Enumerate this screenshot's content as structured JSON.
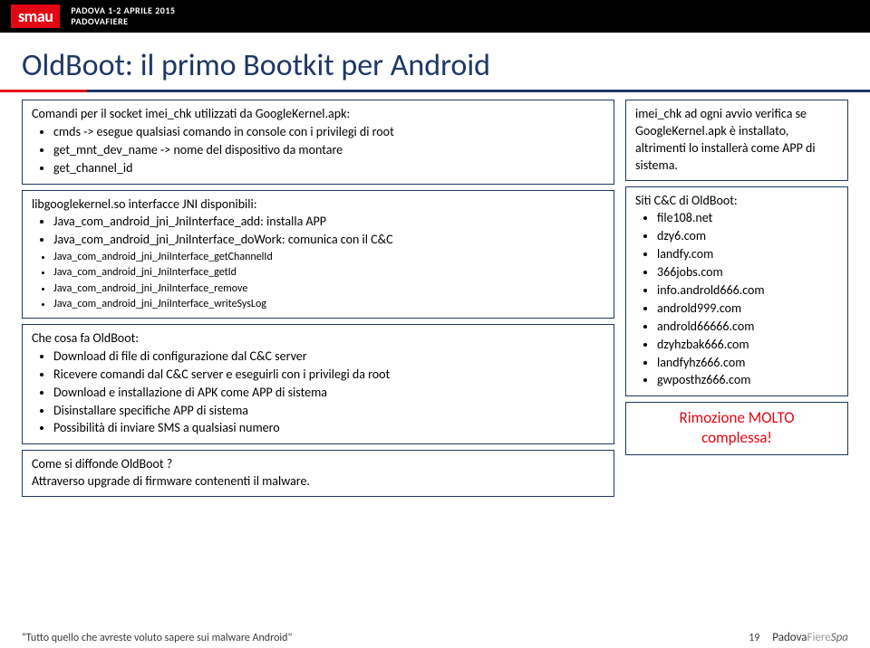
{
  "header": {
    "logo": "smau",
    "line1": "PADOVA 1-2 APRILE 2015",
    "line2": "PADOVAFIERE"
  },
  "title": "OldBoot: il primo Bootkit per Android",
  "left": {
    "box1": {
      "intro": "Comandi per il socket imei_chk utilizzati da GoogleKernel.apk:",
      "items": [
        "cmds -> esegue qualsiasi comando in console con i privilegi di root",
        "get_mnt_dev_name -> nome del dispositivo da montare",
        "get_channel_id"
      ]
    },
    "box2": {
      "intro": "libgooglekernel.so interfacce JNI disponibili:",
      "items": [
        "Java_com_android_jni_JniInterface_add: installa APP",
        "Java_com_android_jni_JniInterface_doWork: comunica con il C&C",
        "Java_com_android_jni_JniInterface_getChannelId",
        "Java_com_android_jni_JniInterface_getId",
        "Java_com_android_jni_JniInterface_remove",
        "Java_com_android_jni_JniInterface_writeSysLog"
      ]
    },
    "box3": {
      "intro": "Che cosa fa OldBoot:",
      "items": [
        "Download di file di configurazione dal C&C server",
        "Ricevere comandi dal C&C server e eseguirli con i privilegi da root",
        "Download e installazione di APK come APP di sistema",
        "Disinstallare specifiche APP di sistema",
        "Possibilità di inviare SMS a qualsiasi numero"
      ]
    },
    "box4": {
      "q": "Come si diffonde OldBoot ?",
      "a": "Attraverso upgrade di firmware contenenti il malware."
    }
  },
  "right": {
    "box1": "imei_chk ad ogni avvio verifica se GoogleKernel.apk è installato, altrimenti lo installerà come APP di sistema.",
    "box2": {
      "intro": "Siti C&C di OldBoot:",
      "items": [
        "file108.net",
        "dzy6.com",
        "landfy.com",
        "366jobs.com",
        "info.androld666.com",
        "androld999.com",
        "androld66666.com",
        "dzyhzbak666.com",
        "landfyhz666.com",
        "gwposthz666.com"
      ]
    },
    "box3_l1": "Rimozione MOLTO",
    "box3_l2": "complessa!"
  },
  "footer": {
    "quote": "\"Tutto quello che avreste voluto sapere sui malware Android\"",
    "page": "19",
    "logo": "PadovaFiereSpa"
  }
}
